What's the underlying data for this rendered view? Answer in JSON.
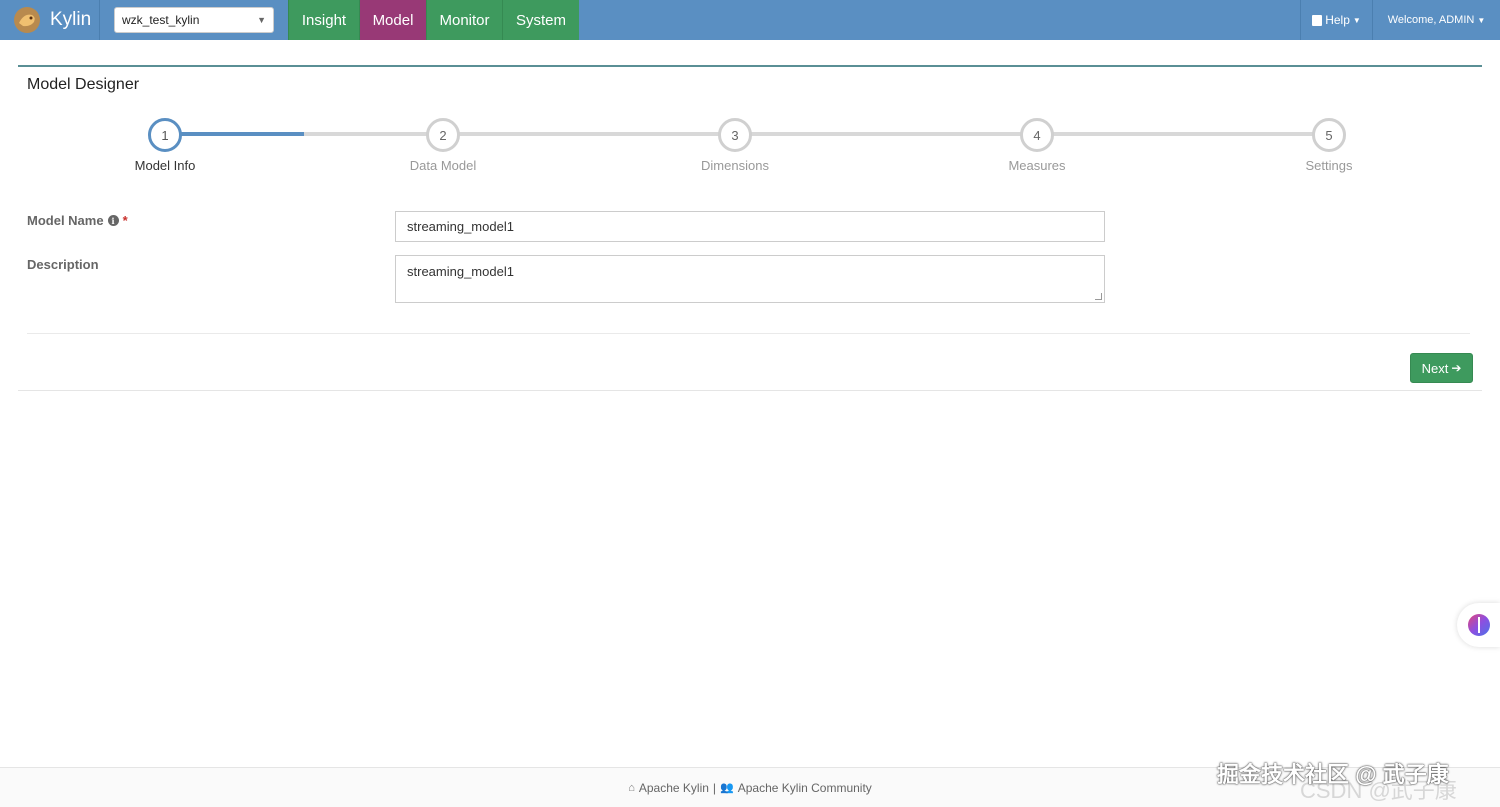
{
  "brand": {
    "name": "Kylin",
    "logo_icon": "kylin-logo-icon"
  },
  "project_selector": {
    "value": "wzk_test_kylin"
  },
  "nav": {
    "tabs": [
      {
        "label": "Insight",
        "active": false
      },
      {
        "label": "Model",
        "active": true
      },
      {
        "label": "Monitor",
        "active": false
      },
      {
        "label": "System",
        "active": false
      }
    ],
    "help_label": "Help",
    "welcome_label": "Welcome, ADMIN"
  },
  "panel": {
    "title": "Model Designer"
  },
  "wizard": {
    "current_step": 1,
    "steps": [
      {
        "number": "1",
        "label": "Model Info"
      },
      {
        "number": "2",
        "label": "Data Model"
      },
      {
        "number": "3",
        "label": "Dimensions"
      },
      {
        "number": "4",
        "label": "Measures"
      },
      {
        "number": "5",
        "label": "Settings"
      }
    ]
  },
  "form": {
    "model_name_label": "Model Name",
    "required_mark": "*",
    "model_name_value": "streaming_model1",
    "description_label": "Description",
    "description_value": "streaming_model1"
  },
  "actions": {
    "next_label": "Next"
  },
  "footer": {
    "link1": "Apache Kylin",
    "separator": "|",
    "link2": "Apache Kylin Community"
  },
  "watermark": {
    "text": "掘金技术社区 @ 武子康",
    "faint_text": "CSDN @武子康"
  },
  "colors": {
    "navbar": "#5a8fc2",
    "tab_green": "#3e9a5e",
    "tab_active": "#983976",
    "progress": "#5a8fc2",
    "next_button": "#3e9a5e"
  }
}
